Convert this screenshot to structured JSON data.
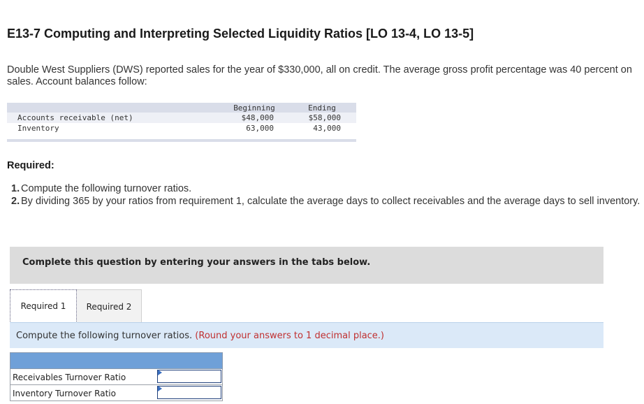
{
  "title": "E13-7 Computing and Interpreting Selected Liquidity Ratios [LO 13-4, LO 13-5]",
  "intro": "Double West Suppliers (DWS) reported sales for the year of $330,000, all on credit. The average gross profit percentage was 40 percent on sales. Account balances follow:",
  "accounts": {
    "headers": {
      "beginning": "Beginning",
      "ending": "Ending"
    },
    "rows": [
      {
        "label": "Accounts receivable (net)",
        "beginning": "$48,000",
        "ending": "$58,000"
      },
      {
        "label": "Inventory",
        "beginning": "63,000",
        "ending": "43,000"
      }
    ]
  },
  "required": {
    "heading": "Required:",
    "items": [
      {
        "num": "1.",
        "text": "Compute the following turnover ratios."
      },
      {
        "num": "2.",
        "text": "By dividing 365 by your ratios from requirement 1, calculate the average days to collect receivables and the average days to sell inventory."
      }
    ]
  },
  "instructions": "Complete this question by entering your answers in the tabs below.",
  "tabs": [
    {
      "label": "Required 1",
      "active": true
    },
    {
      "label": "Required 2",
      "active": false
    }
  ],
  "prompt": {
    "text": "Compute the following turnover ratios.",
    "note": "(Round your answers to 1 decimal place.)"
  },
  "answer_table": {
    "rows": [
      {
        "label": "Receivables Turnover Ratio",
        "value": ""
      },
      {
        "label": "Inventory Turnover Ratio",
        "value": ""
      }
    ]
  },
  "colors": {
    "header_bar": "#6fa0d8",
    "prompt_bg": "#dbe9f8",
    "note_red": "#c03030",
    "instr_bg": "#dcdcdc"
  }
}
